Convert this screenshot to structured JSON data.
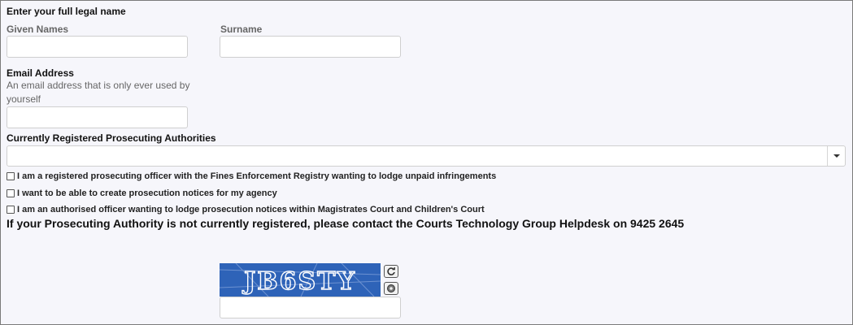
{
  "section_title": "Enter your full legal name",
  "given_names": {
    "label": "Given Names",
    "value": ""
  },
  "surname": {
    "label": "Surname",
    "value": ""
  },
  "email": {
    "label": "Email Address",
    "help_line1": "An email address that is only ever used by",
    "help_line2": "yourself",
    "value": ""
  },
  "authorities": {
    "label": "Currently Registered Prosecuting Authorities",
    "selected": ""
  },
  "checkboxes": [
    {
      "label": "I am a registered prosecuting officer with the Fines Enforcement Registry wanting to lodge unpaid infringements",
      "checked": false
    },
    {
      "label": "I want to be able to create prosecution notices for my agency",
      "checked": false
    },
    {
      "label": "I am an authorised officer wanting to lodge prosecution notices within Magistrates Court and Children's Court",
      "checked": false
    }
  ],
  "notice": "If your Prosecuting Authority is not currently registered, please contact the Courts Technology Group Helpdesk on 9425 2645",
  "captcha": {
    "text": "JB6STY",
    "refresh_icon": "refresh-icon",
    "audio_icon": "audio-icon",
    "value": ""
  },
  "colors": {
    "page_background": "#f6f6fb",
    "captcha_background": "#2e63b8"
  }
}
